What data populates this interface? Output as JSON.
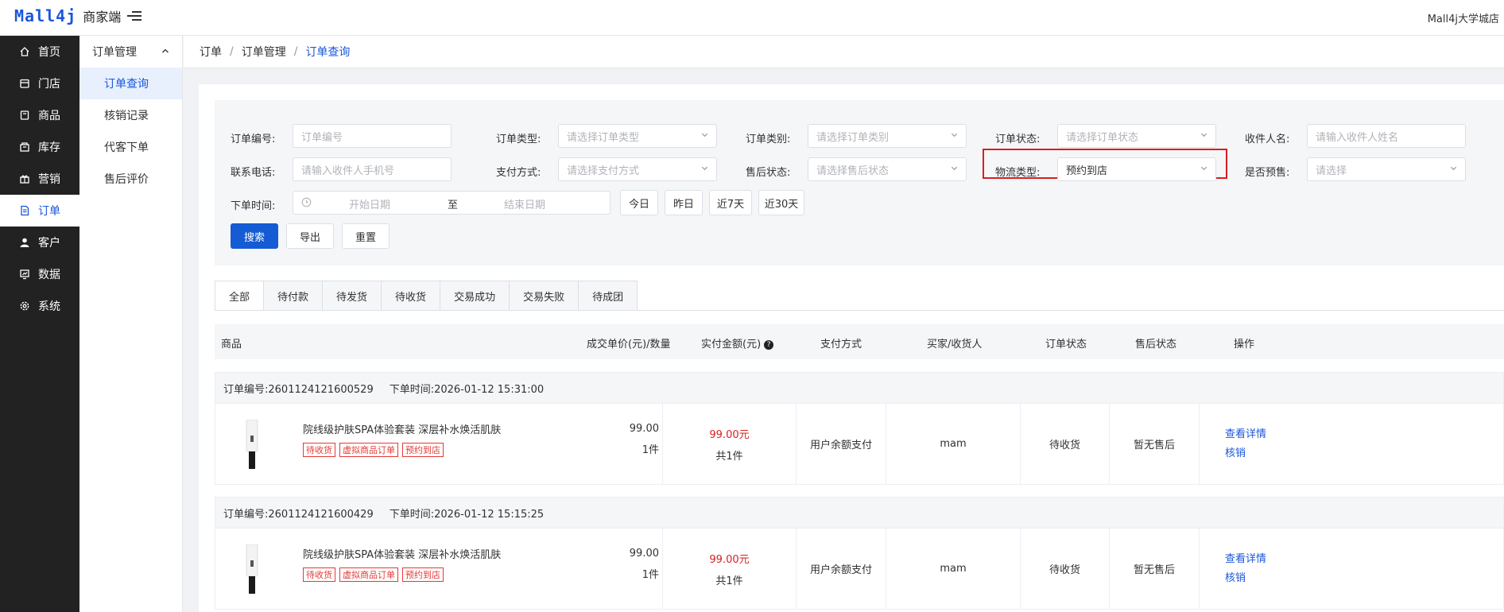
{
  "header": {
    "brand": "Mall4j",
    "brand_sub": "商家端",
    "shop": "Mall4j大学城店"
  },
  "sidebar": {
    "items": [
      {
        "label": "首页",
        "icon": "home-icon"
      },
      {
        "label": "门店",
        "icon": "store-icon"
      },
      {
        "label": "商品",
        "icon": "goods-icon"
      },
      {
        "label": "库存",
        "icon": "inventory-icon"
      },
      {
        "label": "营销",
        "icon": "gift-icon"
      },
      {
        "label": "订单",
        "icon": "order-icon",
        "active": true
      },
      {
        "label": "客户",
        "icon": "user-icon"
      },
      {
        "label": "数据",
        "icon": "chart-icon"
      },
      {
        "label": "系统",
        "icon": "gear-icon"
      }
    ]
  },
  "submenu": {
    "title": "订单管理",
    "items": [
      "订单查询",
      "核销记录",
      "代客下单",
      "售后评价"
    ]
  },
  "breadcrumb": [
    "订单",
    "订单管理",
    "订单查询"
  ],
  "filters": {
    "order_no_label": "订单编号:",
    "order_no_placeholder": "订单编号",
    "order_type_label": "订单类型:",
    "order_type_placeholder": "请选择订单类型",
    "order_cat_label": "订单类别:",
    "order_cat_placeholder": "请选择订单类别",
    "order_status_label": "订单状态:",
    "order_status_placeholder": "请选择订单状态",
    "receiver_label": "收件人名:",
    "receiver_placeholder": "请输入收件人姓名",
    "phone_label": "联系电话:",
    "phone_placeholder": "请输入收件人手机号",
    "pay_label": "支付方式:",
    "pay_placeholder": "请选择支付方式",
    "after_label": "售后状态:",
    "after_placeholder": "请选择售后状态",
    "logistics_label": "物流类型:",
    "logistics_value": "预约到店",
    "presale_label": "是否预售:",
    "presale_placeholder": "请选择",
    "time_label": "下单时间:",
    "start_placeholder": "开始日期",
    "to": "至",
    "end_placeholder": "结束日期",
    "quick": [
      "今日",
      "昨日",
      "近7天",
      "近30天"
    ],
    "search": "搜索",
    "export": "导出",
    "reset": "重置"
  },
  "tabs": [
    "全部",
    "待付款",
    "待发货",
    "待收货",
    "交易成功",
    "交易失败",
    "待成团"
  ],
  "table": {
    "headers": {
      "product": "商品",
      "unit": "成交单价(元)/数量",
      "paid": "实付金额(元)",
      "help": "?",
      "pay": "支付方式",
      "buyer": "买家/收货人",
      "status": "订单状态",
      "after": "售后状态",
      "op": "操作"
    }
  },
  "orders": [
    {
      "no": "订单编号:2601124121600529",
      "time": "下单时间:2026-01-12 15:31:00",
      "name": "院线级护肤SPA体验套装 深层补水焕活肌肤",
      "tags": [
        "待收货",
        "虚拟商品订单",
        "预约到店"
      ],
      "price": "99.00",
      "qty": "1件",
      "paid": "99.00元",
      "paid_qty": "共1件",
      "pay": "用户余额支付",
      "buyer": "mam",
      "status": "待收货",
      "after": "暂无售后",
      "op1": "查看详情",
      "op2": "核销"
    },
    {
      "no": "订单编号:2601124121600429",
      "time": "下单时间:2026-01-12 15:15:25",
      "name": "院线级护肤SPA体验套装 深层补水焕活肌肤",
      "tags": [
        "待收货",
        "虚拟商品订单",
        "预约到店"
      ],
      "price": "99.00",
      "qty": "1件",
      "paid": "99.00元",
      "paid_qty": "共1件",
      "pay": "用户余额支付",
      "buyer": "mam",
      "status": "待收货",
      "after": "暂无售后",
      "op1": "查看详情",
      "op2": "核销"
    }
  ],
  "colors": {
    "accent": "#1a56db",
    "sidebar": "#222222",
    "price": "#d81e1e",
    "highlight": "#d81e1e"
  }
}
